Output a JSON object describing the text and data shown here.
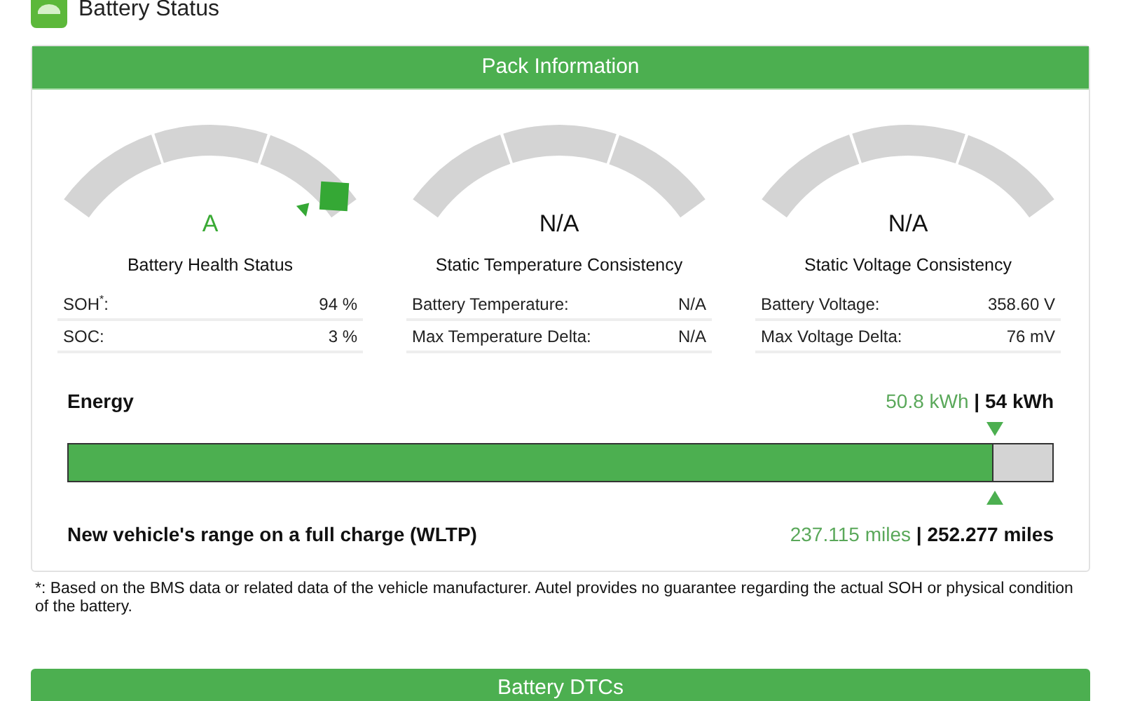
{
  "page": {
    "title": "Battery Status"
  },
  "pack_panel": {
    "title": "Pack Information",
    "gauges": [
      {
        "kind": "pointer",
        "value": "A",
        "color": "#3aaa35",
        "label": "Battery Health Status",
        "rows": [
          {
            "label": "SOH$^{*}$:",
            "value": "94 %"
          },
          {
            "label": "SOC:",
            "value": "3 %"
          }
        ]
      },
      {
        "kind": "plain",
        "value": "N/A",
        "color": "#111111",
        "label": "Static Temperature Consistency",
        "rows": [
          {
            "label": "Battery Temperature:",
            "value": "N/A"
          },
          {
            "label": "Max Temperature Delta:",
            "value": "N/A"
          }
        ]
      },
      {
        "kind": "plain",
        "value": "N/A",
        "color": "#111111",
        "label": "Static Voltage Consistency",
        "rows": [
          {
            "label": "Battery Voltage:",
            "value": "358.60 V"
          },
          {
            "label": "Max Voltage Delta:",
            "value": "76 mV"
          }
        ]
      }
    ],
    "energy": {
      "label": "Energy",
      "current": "50.8 kWh",
      "separator": "|",
      "total": "54 kWh",
      "level": 0.94,
      "range_label": "New vehicle's range on a full charge (WLTP)",
      "range_current": "237.115 miles",
      "range_separator": "|",
      "range_total": "252.277 miles"
    }
  },
  "footnote": "*: Based on the BMS data or related data of the vehicle manufacturer. Autel provides no guarantee regarding the actual SOH or physical condition of the battery.",
  "dtc_panel": {
    "title": "Battery DTCs"
  }
}
